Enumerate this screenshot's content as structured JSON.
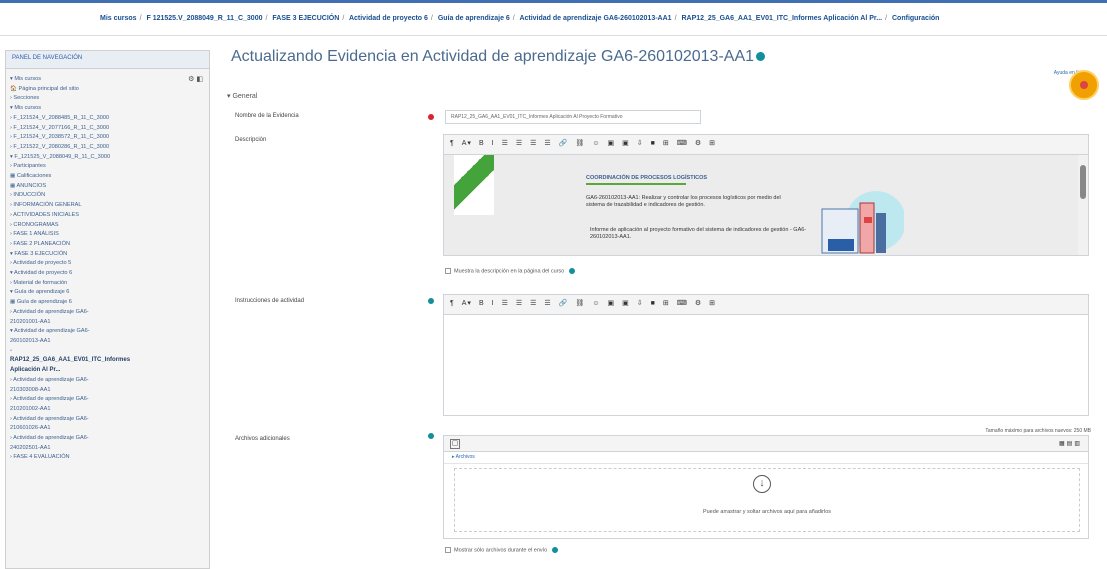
{
  "breadcrumb": {
    "items": [
      "Mis cursos",
      "F 121525.V_2088049_R_11_C_3000",
      "FASE 3 EJECUCIÓN",
      "Actividad de proyecto 6",
      "Guía de aprendizaje 6",
      "Actividad de aprendizaje GA6-260102013-AA1",
      "RAP12_25_GA6_AA1_EV01_ITC_Informes Aplicación Al Pr...",
      "Configuración"
    ]
  },
  "nav": {
    "title": "PANEL DE NAVEGACIÓN",
    "tree": [
      "▾ Mis cursos",
      "🏠 Página principal del sitio",
      "› Secciones",
      "▾ Mis cursos",
      "› F_121524_V_2088485_R_11_C_3000",
      "› F_121524_V_2077166_R_11_C_3000",
      "› F_121524_V_2038572_R_11_C_3000",
      "› F_121522_V_2080286_R_11_C_3000",
      "▾ F_121525_V_2088049_R_11_C_3000",
      "  › Participantes",
      "  ▦ Calificaciones",
      "  ▦ ANUNCIOS",
      "  › INDUCCIÓN",
      "  › INFORMACIÓN GENERAL",
      "  › ACTIVIDADES INICIALES",
      "  › CRONOGRAMAS",
      "  › FASE 1 ANÁLISIS",
      "  › FASE 2 PLANEACIÓN",
      "  ▾ FASE 3 EJECUCIÓN",
      "    › Actividad de proyecto 5",
      "    ▾ Actividad de proyecto 6",
      "      › Material de formación",
      "      ▾ Guía de aprendizaje 6",
      "        ▦ Guía de aprendizaje 6",
      "        › Actividad de aprendizaje GA6-",
      "          210201001-AA1",
      "        ▾ Actividad de aprendizaje GA6-",
      "          260102013-AA1",
      "          ▫",
      "          RAP12_25_GA6_AA1_EV01_ITC_Informes",
      "          Aplicación Al Pr...",
      "        › Actividad de aprendizaje GA6-",
      "          210303008-AA1",
      "        › Actividad de aprendizaje GA6-",
      "          210201002-AA1",
      "        › Actividad de aprendizaje GA6-",
      "          210601026-AA1",
      "        › Actividad de aprendizaje GA6-",
      "          240202501-AA1",
      "  › FASE 4 EVALUACIÓN"
    ]
  },
  "page": {
    "title": "Actualizando Evidencia en Actividad de aprendizaje GA6-260102013-AA1",
    "section": "General",
    "help_badge": "Ayuda en línea"
  },
  "form": {
    "name_label": "Nombre de la Evidencia",
    "name_value": "RAP12_25_GA6_AA1_EV01_ITC_Informes Aplicación Al Proyecto Formativo",
    "description_label": "Descripción",
    "description_doc": {
      "heading": "COORDINACIÓN DE PROCESOS LOGÍSTICOS",
      "body": "GA6-260102013-AA1: Realizar y controlar los procesos logísticos por medio del sistema de trazabilidad e indicadores de gestión.",
      "bullet": "Informe de aplicación al proyecto formativo del sistema de indicadores de gestión - GA6-260102013-AA1."
    },
    "show_description": "Muestra la descripción en la página del curso",
    "instructions_label": "Instrucciones de actividad",
    "files_label": "Archivos adicionales",
    "max_size": "Tamaño máximo para archivos nuevos: 250 MB",
    "files_folder": "Archivos",
    "drop_text": "Puede arrastrar y soltar archivos aquí para añadirlos",
    "only_files": "Mostrar sólo archivos durante el envío"
  },
  "toolbar": [
    "¶",
    "A▾",
    "B",
    "I",
    "☰",
    "☰",
    "☰",
    "☰",
    "🔗",
    "⛓",
    "☺",
    "▣",
    "▣",
    "⇩",
    "■",
    "⊞",
    "⌨",
    "⚙",
    "⊞"
  ]
}
